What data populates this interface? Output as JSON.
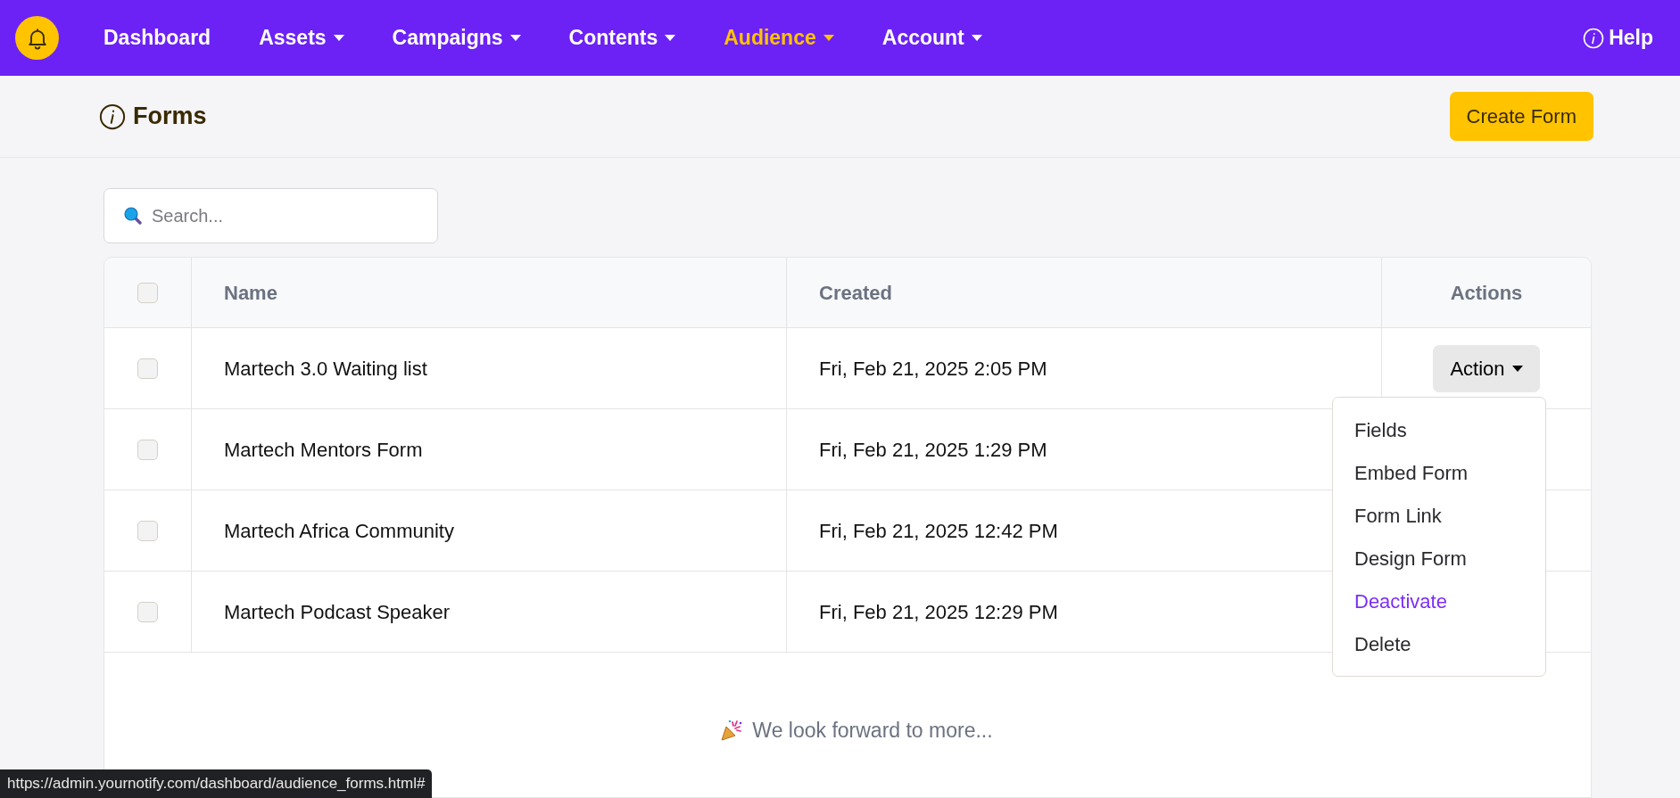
{
  "nav": {
    "items": [
      {
        "label": "Dashboard",
        "dropdown": false,
        "selected": false
      },
      {
        "label": "Assets",
        "dropdown": true,
        "selected": false
      },
      {
        "label": "Campaigns",
        "dropdown": true,
        "selected": false
      },
      {
        "label": "Contents",
        "dropdown": true,
        "selected": false
      },
      {
        "label": "Audience",
        "dropdown": true,
        "selected": true
      },
      {
        "label": "Account",
        "dropdown": true,
        "selected": false
      }
    ],
    "help": "Help"
  },
  "page": {
    "title": "Forms",
    "create_button": "Create Form"
  },
  "search": {
    "placeholder": "Search..."
  },
  "table": {
    "header_checked": false,
    "columns": [
      "Name",
      "Created",
      "Actions"
    ],
    "rows": [
      {
        "checked": false,
        "name": "Martech 3.0 Waiting list",
        "created": "Fri, Feb 21, 2025 2:05 PM",
        "action": "Action"
      },
      {
        "checked": false,
        "name": "Martech Mentors Form",
        "created": "Fri, Feb 21, 2025 1:29 PM"
      },
      {
        "checked": false,
        "name": "Martech Africa Community",
        "created": "Fri, Feb 21, 2025 12:42 PM"
      },
      {
        "checked": false,
        "name": "Martech Podcast Speaker",
        "created": "Fri, Feb 21, 2025 12:29 PM"
      }
    ],
    "footer": "We look forward to more..."
  },
  "action_menu": {
    "items": [
      {
        "label": "Fields",
        "highlighted": false
      },
      {
        "label": "Embed Form",
        "highlighted": false
      },
      {
        "label": "Form Link",
        "highlighted": false
      },
      {
        "label": "Design Form",
        "highlighted": false
      },
      {
        "label": "Deactivate",
        "highlighted": true
      },
      {
        "label": "Delete",
        "highlighted": false
      }
    ]
  },
  "status_url": "https://admin.yournotify.com/dashboard/audience_forms.html#"
}
